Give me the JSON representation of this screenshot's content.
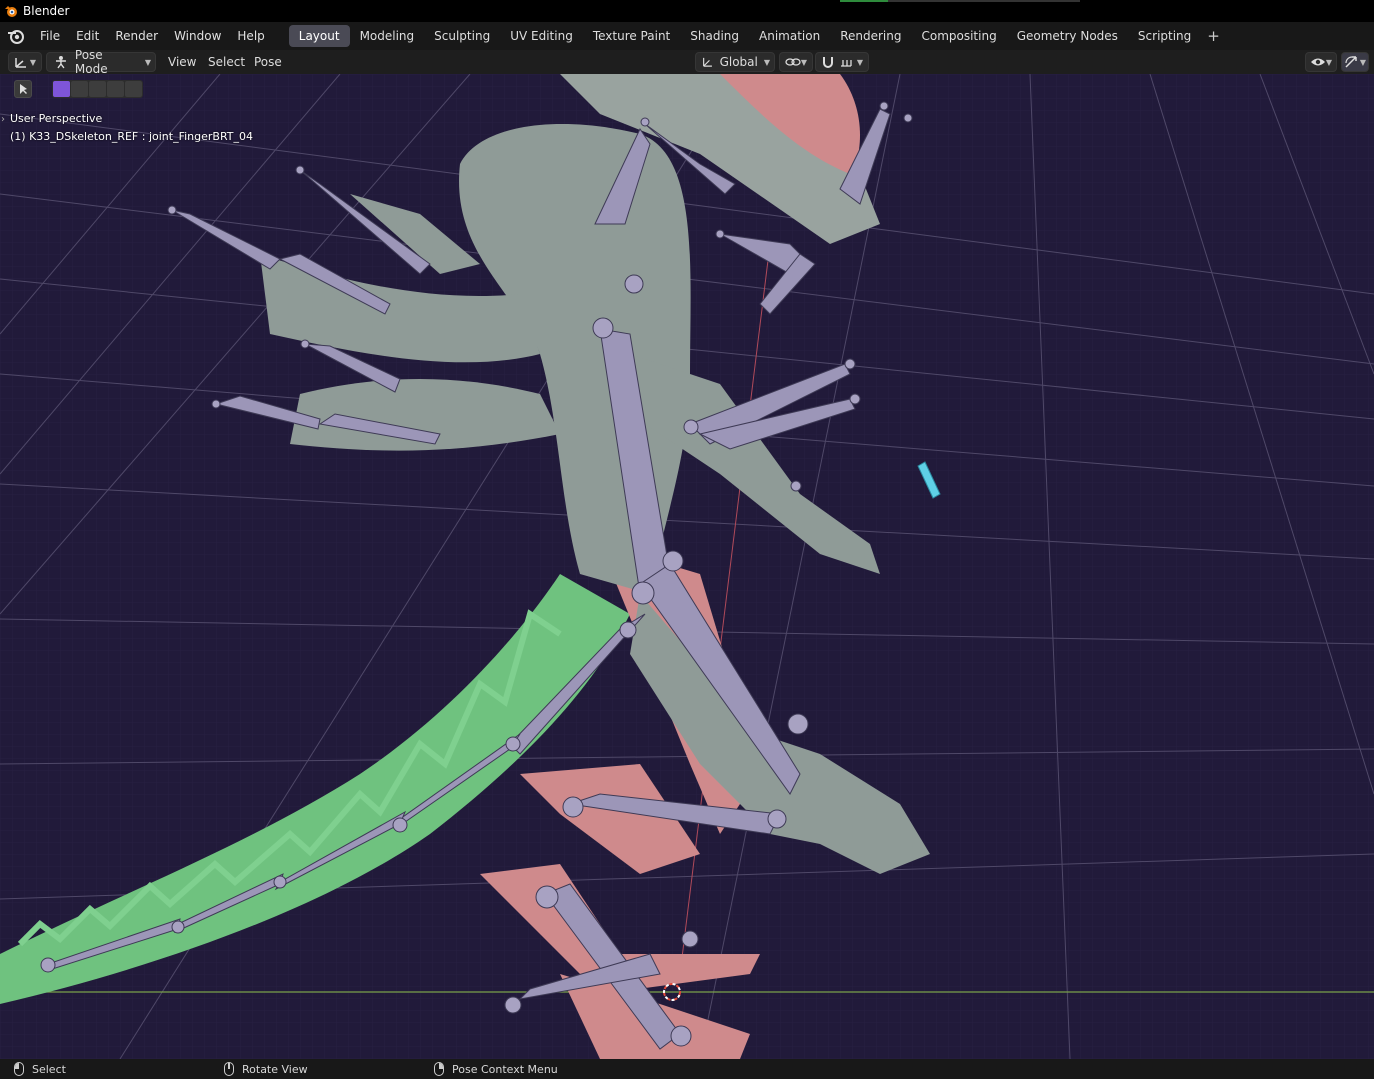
{
  "window": {
    "title": "Blender"
  },
  "menubar": {
    "items": [
      "File",
      "Edit",
      "Render",
      "Window",
      "Help"
    ],
    "workspaces": [
      "Layout",
      "Modeling",
      "Sculpting",
      "UV Editing",
      "Texture Paint",
      "Shading",
      "Animation",
      "Rendering",
      "Compositing",
      "Geometry Nodes",
      "Scripting"
    ],
    "active_workspace": "Layout",
    "add_label": "+"
  },
  "header": {
    "mode": "Pose Mode",
    "menus": [
      "View",
      "Select",
      "Pose"
    ],
    "orientation": "Global"
  },
  "viewport": {
    "perspective_label": "User Perspective",
    "object_label": "(1) K33_DSkeleton_REF : joint_FingerBRT_04"
  },
  "statusbar": {
    "left": "Select",
    "middle": "Rotate View",
    "right": "Pose Context Menu"
  },
  "colors": {
    "background": "#221b3a",
    "grid": "#4a4560",
    "bone": "#9c96b8",
    "bone_selected": "#5fd0e6",
    "mesh_body": "#8e9a95",
    "mesh_tail": "#6fc27f",
    "mesh_legs": "#d08a8a",
    "accent_purple": "#7e55d8"
  }
}
